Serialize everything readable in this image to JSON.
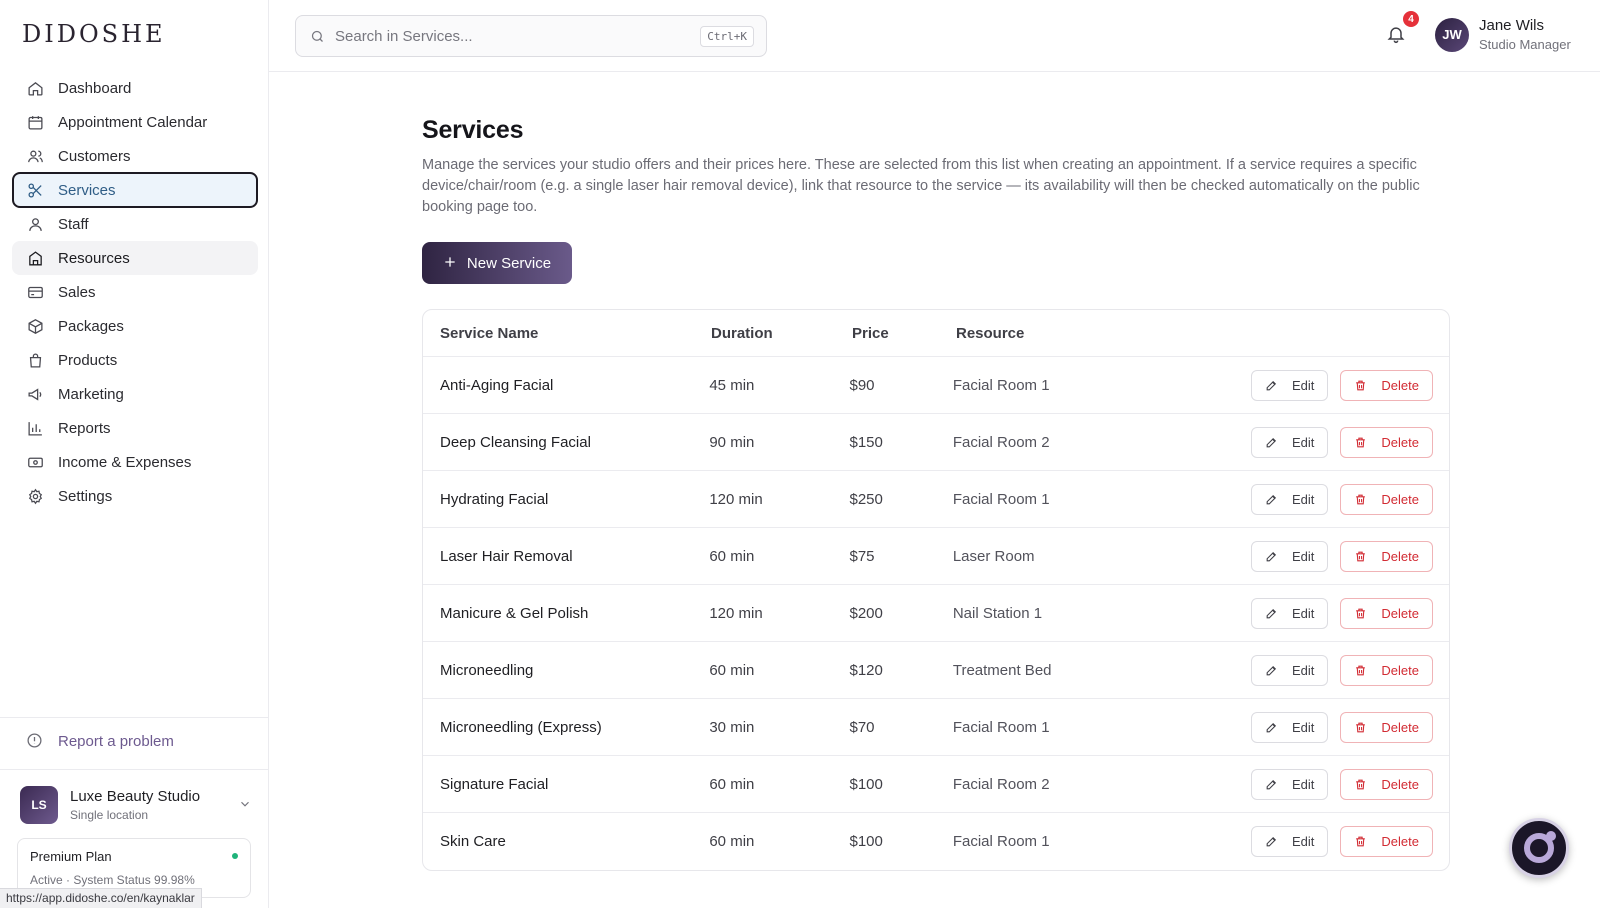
{
  "brand": {
    "logo_text": "DIDOSHE"
  },
  "sidebar": {
    "items": [
      {
        "label": "Dashboard",
        "icon": "home-icon"
      },
      {
        "label": "Appointment Calendar",
        "icon": "calendar-icon"
      },
      {
        "label": "Customers",
        "icon": "users-icon"
      },
      {
        "label": "Services",
        "icon": "scissors-icon",
        "active": true
      },
      {
        "label": "Staff",
        "icon": "user-icon"
      },
      {
        "label": "Resources",
        "icon": "building-icon",
        "hovered": true
      },
      {
        "label": "Sales",
        "icon": "card-icon"
      },
      {
        "label": "Packages",
        "icon": "package-icon"
      },
      {
        "label": "Products",
        "icon": "bag-icon"
      },
      {
        "label": "Marketing",
        "icon": "megaphone-icon"
      },
      {
        "label": "Reports",
        "icon": "bar-chart-icon"
      },
      {
        "label": "Income & Expenses",
        "icon": "cash-icon"
      },
      {
        "label": "Settings",
        "icon": "gear-icon"
      }
    ],
    "report_problem": "Report a problem",
    "studio": {
      "initials": "LS",
      "name": "Luxe Beauty Studio",
      "subtitle": "Single location"
    },
    "plan": {
      "name": "Premium Plan",
      "status": "Active · System Status 99.98%"
    },
    "status_url": "https://app.didoshe.co/en/kaynaklar"
  },
  "header": {
    "search": {
      "placeholder": "Search in Services...",
      "shortcut": "Ctrl+K"
    },
    "notifications_count": "4",
    "user": {
      "initials": "JW",
      "name": "Jane Wils",
      "role": "Studio Manager"
    }
  },
  "main": {
    "title": "Services",
    "description": "Manage the services your studio offers and their prices here. These are selected from this list when creating an appointment. If a service requires a specific device/chair/room (e.g. a single laser hair removal device), link that resource to the service — its availability will then be checked automatically on the public booking page too.",
    "new_button": "New Service",
    "table": {
      "headers": [
        "Service Name",
        "Duration",
        "Price",
        "Resource"
      ],
      "edit_label": "Edit",
      "delete_label": "Delete",
      "rows": [
        {
          "name": "Anti-Aging Facial",
          "duration": "45 min",
          "price": "$90",
          "resource": "Facial Room 1"
        },
        {
          "name": "Deep Cleansing Facial",
          "duration": "90 min",
          "price": "$150",
          "resource": "Facial Room 2"
        },
        {
          "name": "Hydrating Facial",
          "duration": "120 min",
          "price": "$250",
          "resource": "Facial Room 1"
        },
        {
          "name": "Laser Hair Removal",
          "duration": "60 min",
          "price": "$75",
          "resource": "Laser Room"
        },
        {
          "name": "Manicure & Gel Polish",
          "duration": "120 min",
          "price": "$200",
          "resource": "Nail Station 1"
        },
        {
          "name": "Microneedling",
          "duration": "60 min",
          "price": "$120",
          "resource": "Treatment Bed"
        },
        {
          "name": "Microneedling (Express)",
          "duration": "30 min",
          "price": "$70",
          "resource": "Facial Room 1"
        },
        {
          "name": "Signature Facial",
          "duration": "60 min",
          "price": "$100",
          "resource": "Facial Room 2"
        },
        {
          "name": "Skin Care",
          "duration": "60 min",
          "price": "$100",
          "resource": "Facial Room 1"
        }
      ]
    }
  },
  "colors": {
    "accent": "#3b2a52",
    "active_nav_bg": "#edf4fb",
    "danger": "#d22b33",
    "badge": "#e5313a"
  }
}
